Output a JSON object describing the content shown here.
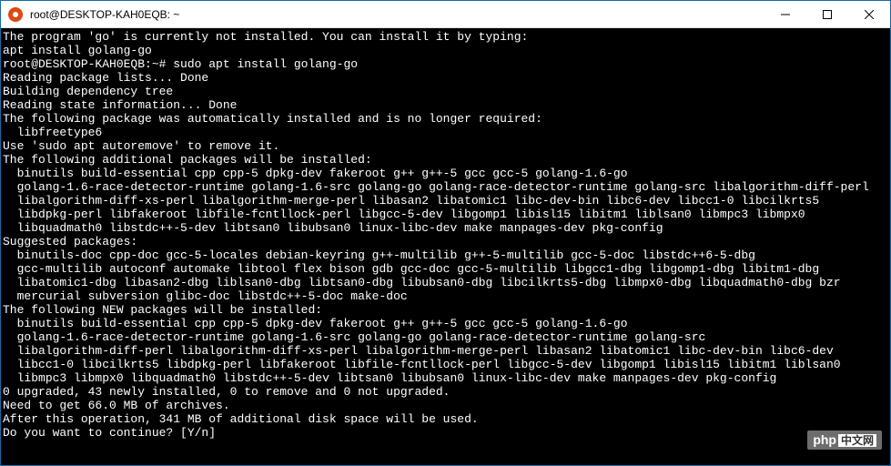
{
  "window": {
    "title": "root@DESKTOP-KAH0EQB: ~"
  },
  "terminal": {
    "lines": [
      "The program 'go' is currently not installed. You can install it by typing:",
      "apt install golang-go",
      "root@DESKTOP-KAH0EQB:~# sudo apt install golang-go",
      "Reading package lists... Done",
      "Building dependency tree",
      "Reading state information... Done",
      "The following package was automatically installed and is no longer required:",
      "  libfreetype6",
      "Use 'sudo apt autoremove' to remove it.",
      "The following additional packages will be installed:",
      "  binutils build-essential cpp cpp-5 dpkg-dev fakeroot g++ g++-5 gcc gcc-5 golang-1.6-go",
      "  golang-1.6-race-detector-runtime golang-1.6-src golang-go golang-race-detector-runtime golang-src libalgorithm-diff-perl",
      "  libalgorithm-diff-xs-perl libalgorithm-merge-perl libasan2 libatomic1 libc-dev-bin libc6-dev libcc1-0 libcilkrts5",
      "  libdpkg-perl libfakeroot libfile-fcntllock-perl libgcc-5-dev libgomp1 libisl15 libitm1 liblsan0 libmpc3 libmpx0",
      "  libquadmath0 libstdc++-5-dev libtsan0 libubsan0 linux-libc-dev make manpages-dev pkg-config",
      "Suggested packages:",
      "  binutils-doc cpp-doc gcc-5-locales debian-keyring g++-multilib g++-5-multilib gcc-5-doc libstdc++6-5-dbg",
      "  gcc-multilib autoconf automake libtool flex bison gdb gcc-doc gcc-5-multilib libgcc1-dbg libgomp1-dbg libitm1-dbg",
      "  libatomic1-dbg libasan2-dbg liblsan0-dbg libtsan0-dbg libubsan0-dbg libcilkrts5-dbg libmpx0-dbg libquadmath0-dbg bzr",
      "  mercurial subversion glibc-doc libstdc++-5-doc make-doc",
      "The following NEW packages will be installed:",
      "  binutils build-essential cpp cpp-5 dpkg-dev fakeroot g++ g++-5 gcc gcc-5 golang-1.6-go",
      "  golang-1.6-race-detector-runtime golang-1.6-src golang-go golang-race-detector-runtime golang-src",
      "  libalgorithm-diff-perl libalgorithm-diff-xs-perl libalgorithm-merge-perl libasan2 libatomic1 libc-dev-bin libc6-dev",
      "  libcc1-0 libcilkrts5 libdpkg-perl libfakeroot libfile-fcntllock-perl libgcc-5-dev libgomp1 libisl15 libitm1 liblsan0",
      "  libmpc3 libmpx0 libquadmath0 libstdc++-5-dev libtsan0 libubsan0 linux-libc-dev make manpages-dev pkg-config",
      "0 upgraded, 43 newly installed, 0 to remove and 0 not upgraded.",
      "Need to get 66.0 MB of archives.",
      "After this operation, 341 MB of additional disk space will be used.",
      "Do you want to continue? [Y/n]"
    ]
  },
  "watermark": {
    "php": "php",
    "cn": "中文网"
  }
}
